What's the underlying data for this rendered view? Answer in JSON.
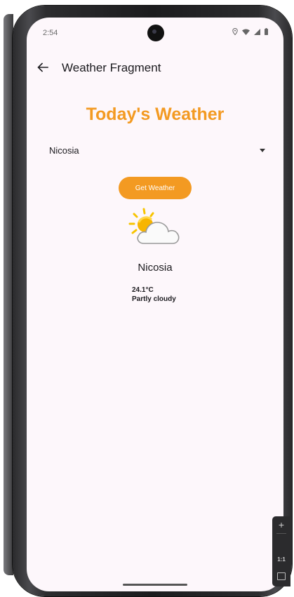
{
  "status_bar": {
    "time": "2:54"
  },
  "app_bar": {
    "title": "Weather Fragment",
    "back_icon": "arrow-back-icon"
  },
  "main": {
    "headline": "Today's Weather",
    "city_spinner": {
      "selected": "Nicosia"
    },
    "get_weather_label": "Get Weather",
    "weather_icon": "partly-cloudy-icon",
    "result": {
      "city": "Nicosia",
      "temperature": "24.1°C",
      "condition": "Partly cloudy"
    }
  },
  "emulator_controls": {
    "zoom_in": "+",
    "zoom_reset": "1:1"
  },
  "colors": {
    "accent": "#f39a22",
    "screen_background": "#fdf7fb",
    "text": "#1c1b1f"
  }
}
